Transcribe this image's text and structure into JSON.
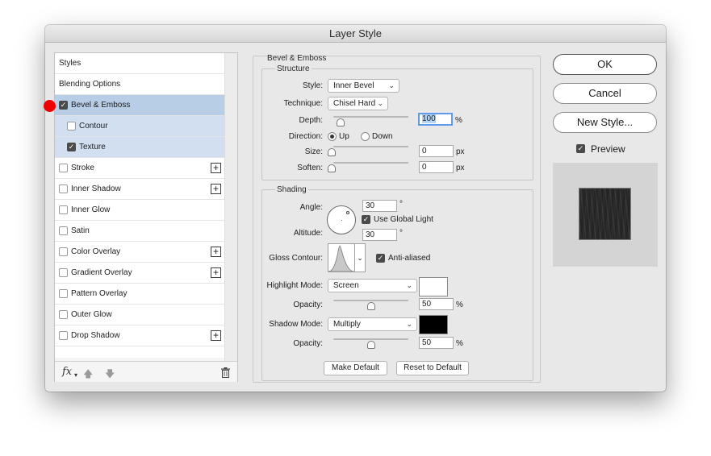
{
  "window": {
    "title": "Layer Style"
  },
  "style_list": {
    "items": [
      {
        "label": "Styles"
      },
      {
        "label": "Blending Options"
      },
      {
        "label": "Bevel & Emboss",
        "checked": true
      },
      {
        "label": "Contour",
        "checked": false
      },
      {
        "label": "Texture",
        "checked": true
      },
      {
        "label": "Stroke",
        "checked": false
      },
      {
        "label": "Inner Shadow",
        "checked": false
      },
      {
        "label": "Inner Glow",
        "checked": false
      },
      {
        "label": "Satin",
        "checked": false
      },
      {
        "label": "Color Overlay",
        "checked": false
      },
      {
        "label": "Gradient Overlay",
        "checked": false
      },
      {
        "label": "Pattern Overlay",
        "checked": false
      },
      {
        "label": "Outer Glow",
        "checked": false
      },
      {
        "label": "Drop Shadow",
        "checked": false
      }
    ],
    "fx_label": "fx"
  },
  "bevel": {
    "section_title": "Bevel & Emboss",
    "structure_title": "Structure",
    "style_label": "Style:",
    "style_value": "Inner Bevel",
    "technique_label": "Technique:",
    "technique_value": "Chisel Hard",
    "depth_label": "Depth:",
    "depth_value": "100",
    "depth_unit": "%",
    "direction_label": "Direction:",
    "direction_up": "Up",
    "direction_down": "Down",
    "direction_selected": "Up",
    "size_label": "Size:",
    "size_value": "0",
    "size_unit": "px",
    "soften_label": "Soften:",
    "soften_value": "0",
    "soften_unit": "px"
  },
  "shading": {
    "title": "Shading",
    "angle_label": "Angle:",
    "angle_value": "30",
    "degree_symbol": "°",
    "use_global_light_label": "Use Global Light",
    "use_global_light_checked": true,
    "altitude_label": "Altitude:",
    "altitude_value": "30",
    "gloss_contour_label": "Gloss Contour:",
    "anti_aliased_label": "Anti-aliased",
    "anti_aliased_checked": true,
    "highlight_mode_label": "Highlight Mode:",
    "highlight_mode_value": "Screen",
    "highlight_color": "#ffffff",
    "highlight_opacity_label": "Opacity:",
    "highlight_opacity_value": "50",
    "shadow_mode_label": "Shadow Mode:",
    "shadow_mode_value": "Multiply",
    "shadow_color": "#000000",
    "shadow_opacity_label": "Opacity:",
    "shadow_opacity_value": "50",
    "percent": "%"
  },
  "buttons": {
    "make_default": "Make Default",
    "reset_to_default": "Reset to Default",
    "ok": "OK",
    "cancel": "Cancel",
    "new_style": "New Style..."
  },
  "preview": {
    "label": "Preview",
    "checked": true
  },
  "colors": {
    "selected_row": "#b8cde6",
    "sub_row": "#d2dff0",
    "focus_ring": "#5d9ce8",
    "marker": "#ee0000"
  }
}
